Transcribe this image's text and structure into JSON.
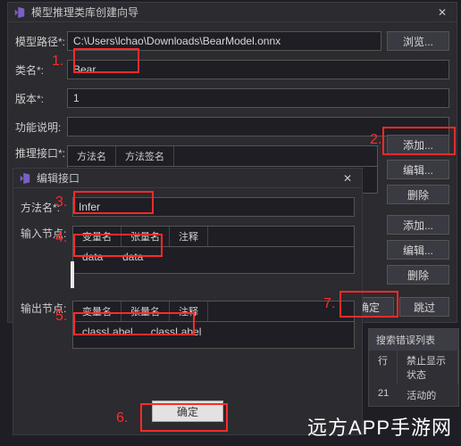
{
  "main_window": {
    "title": "模型推理类库创建向导",
    "model_path_label": "模型路径*:",
    "model_path_value": "C:\\Users\\lchao\\Downloads\\BearModel.onnx",
    "browse_label": "浏览...",
    "class_name_label": "类名*:",
    "class_name_value": "Bear",
    "version_label": "版本*:",
    "version_value": "1",
    "function_desc_label": "功能说明:",
    "function_desc_value": "",
    "infer_interface_label": "推理接口*:",
    "method_name_col": "方法名",
    "method_sig_col": "方法签名",
    "add_label": "添加...",
    "edit_label": "编辑...",
    "delete_label": "删除",
    "confirm_label": "确定",
    "skip_label": "跳过"
  },
  "edit_window": {
    "title": "编辑接口",
    "method_name_label": "方法名*:",
    "method_name_value": "Infer",
    "input_node_label": "输入节点:",
    "output_node_label": "输出节点:",
    "col_varname": "变量名",
    "col_tensorname": "张量名",
    "col_comment": "注释",
    "input_varname": "data",
    "input_tensorname": "data",
    "output_varname": "classLabel",
    "output_tensorname": "classLabel",
    "add_label": "添加",
    "edit_label": "编辑...",
    "delete_label": "删除",
    "ok_label": "确定"
  },
  "error_panel": {
    "title": "搜索错误列表",
    "col_line": "行",
    "col_state": "禁止显示状态",
    "row_line": "21",
    "row_state": "活动的"
  },
  "annotations": {
    "a1": "1.",
    "a2": "2.",
    "a3": "3.",
    "a4": "4.",
    "a5": "5.",
    "a6": "6.",
    "a7": "7."
  },
  "watermark_text": "远方APP手游网"
}
